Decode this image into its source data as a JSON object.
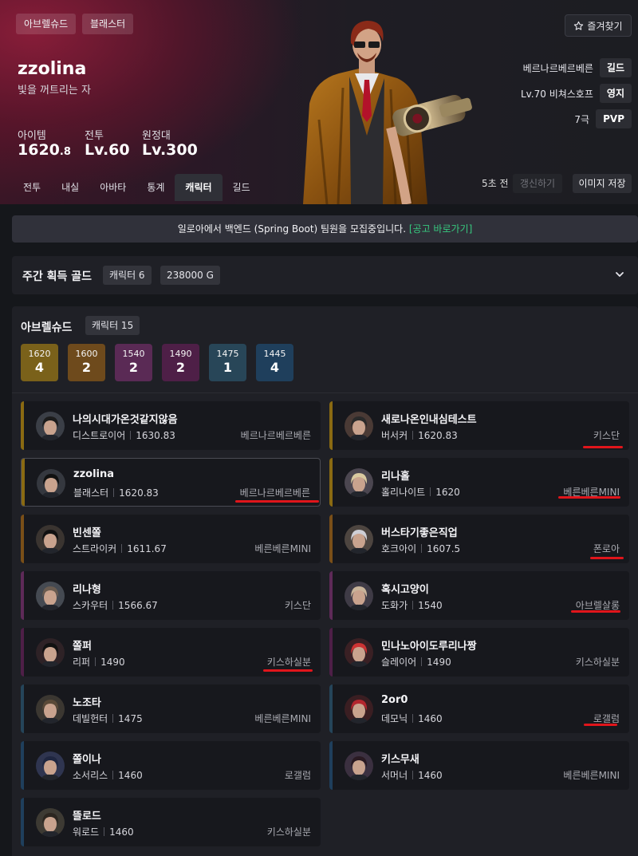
{
  "header": {
    "server_chip": "아브렐슈드",
    "class_chip": "블래스터",
    "name": "zzolina",
    "title": "빛을 꺼트리는 자",
    "stats": [
      {
        "label": "아이템",
        "value": "1620",
        "suffix": ".8"
      },
      {
        "label": "전투",
        "value": "Lv.60",
        "suffix": ""
      },
      {
        "label": "원정대",
        "value": "Lv.300",
        "suffix": ""
      }
    ],
    "tabs": [
      "전투",
      "내실",
      "아바타",
      "통계",
      "캐릭터",
      "길드"
    ],
    "active_tab": "캐릭터",
    "favorite_label": "즐겨찾기",
    "favorite_icon": "star-icon",
    "guild_name": "베르나르베르베른",
    "guild_tag": "길드",
    "estate_name": "Lv.70 비쳐스호프",
    "estate_tag": "영지",
    "pvp_rank": "7극",
    "pvp_tag": "PVP",
    "updated_ago": "5초 전",
    "refresh_label": "갱신하기",
    "save_image_label": "이미지 저장"
  },
  "banner": {
    "text": "일로아에서 백엔드 (Spring Boot) 팀원을 모집중입니다.",
    "link": "[공고 바로가기]",
    "link_color": "#37c97f"
  },
  "weekly_gold": {
    "title": "주간 획득 골드",
    "characters": "캐릭터 6",
    "gold": "238000 G"
  },
  "server": {
    "name": "아브렐슈드",
    "count": "캐릭터 15",
    "levels": [
      {
        "level": "1620",
        "count": "4",
        "color": "#7a611a"
      },
      {
        "level": "1600",
        "count": "2",
        "color": "#6e4a1c"
      },
      {
        "level": "1540",
        "count": "2",
        "color": "#5a2a55"
      },
      {
        "level": "1490",
        "count": "2",
        "color": "#4e1f47"
      },
      {
        "level": "1475",
        "count": "1",
        "color": "#284658"
      },
      {
        "level": "1445",
        "count": "4",
        "color": "#1f3f5c"
      }
    ]
  },
  "characters": [
    {
      "name": "나의시대가온것같지않음",
      "class": "디스트로이어",
      "level": "1630.83",
      "guild": "베르나르베르베른",
      "bar": "#8a6a12"
    },
    {
      "name": "새로나온인내심테스트",
      "class": "버서커",
      "level": "1620.83",
      "guild": "키스단",
      "bar": "#8a6a12"
    },
    {
      "name": "zzolina",
      "class": "블래스터",
      "level": "1620.83",
      "guild": "베르나르베르베른",
      "bar": "#8a6a12"
    },
    {
      "name": "리나홀",
      "class": "홀리나이트",
      "level": "1620",
      "guild": "베른베른MINI",
      "bar": "#8a6a12"
    },
    {
      "name": "빈센쫄",
      "class": "스트라이커",
      "level": "1611.67",
      "guild": "베른베른MINI",
      "bar": "#7a4f18"
    },
    {
      "name": "버스타기좋은직업",
      "class": "호크아이",
      "level": "1607.5",
      "guild": "폰로아",
      "bar": "#7a4f18"
    },
    {
      "name": "리나형",
      "class": "스카우터",
      "level": "1566.67",
      "guild": "키스단",
      "bar": "#5e2a58"
    },
    {
      "name": "혹시고양이",
      "class": "도화가",
      "level": "1540",
      "guild": "아브렐살롱",
      "bar": "#5e2a58"
    },
    {
      "name": "쫄퍼",
      "class": "리퍼",
      "level": "1490",
      "guild": "키스하실분",
      "bar": "#4e1f47"
    },
    {
      "name": "민나노아이도루리나짱",
      "class": "슬레이어",
      "level": "1490",
      "guild": "키스하실분",
      "bar": "#4e1f47"
    },
    {
      "name": "노조타",
      "class": "데빌헌터",
      "level": "1475",
      "guild": "베른베른MINI",
      "bar": "#25455a"
    },
    {
      "name": "2or0",
      "class": "데모닉",
      "level": "1460",
      "guild": "로갤럼",
      "bar": "#25455a"
    },
    {
      "name": "쫄이나",
      "class": "소서리스",
      "level": "1460",
      "guild": "로갤럼",
      "bar": "#1f3f5c"
    },
    {
      "name": "키스무새",
      "class": "서머너",
      "level": "1460",
      "guild": "베른베른MINI",
      "bar": "#1f3f5c"
    },
    {
      "name": "뜰로드",
      "class": "워로드",
      "level": "1460",
      "guild": "키스하실분",
      "bar": "#1f3f5c"
    }
  ],
  "annotation_color": "#e0151b"
}
